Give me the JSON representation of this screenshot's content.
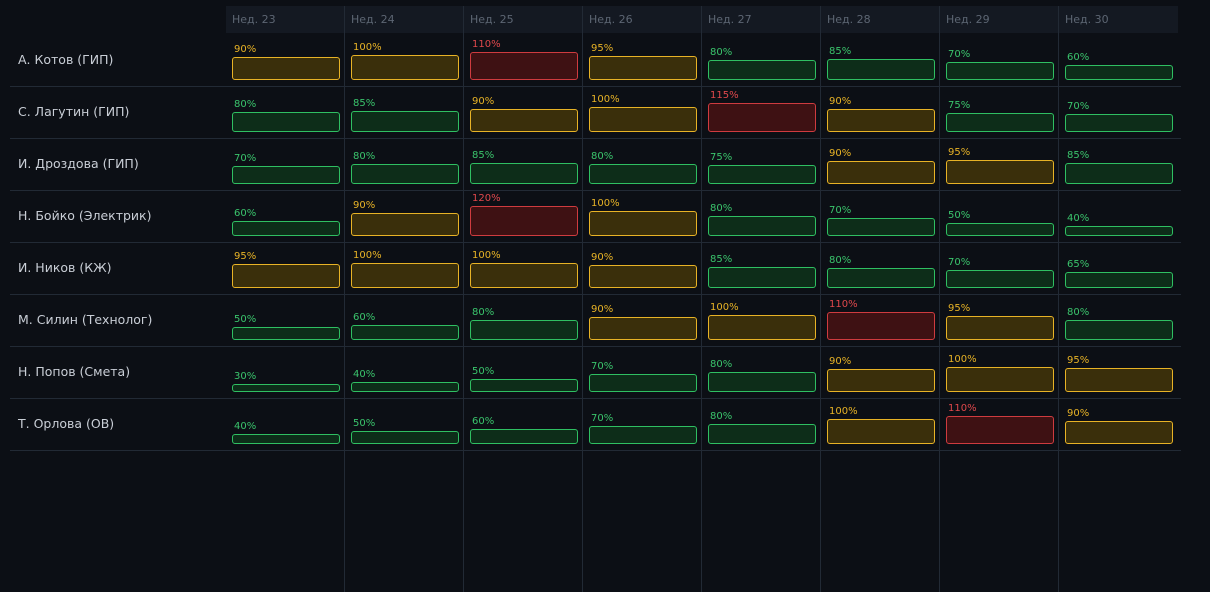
{
  "weeks": [
    "Нед. 23",
    "Нед. 24",
    "Нед. 25",
    "Нед. 26",
    "Нед. 27",
    "Нед. 28",
    "Нед. 29",
    "Нед. 30"
  ],
  "people": [
    {
      "name": "А. Котов (ГИП)",
      "load": [
        90,
        100,
        110,
        95,
        80,
        85,
        70,
        60
      ]
    },
    {
      "name": "С. Лагутин (ГИП)",
      "load": [
        80,
        85,
        90,
        100,
        115,
        90,
        75,
        70
      ]
    },
    {
      "name": "И. Дроздова (ГИП)",
      "load": [
        70,
        80,
        85,
        80,
        75,
        90,
        95,
        85
      ]
    },
    {
      "name": "Н. Бойко (Электрик)",
      "load": [
        60,
        90,
        120,
        100,
        80,
        70,
        50,
        40
      ]
    },
    {
      "name": "И. Ников (КЖ)",
      "load": [
        95,
        100,
        100,
        90,
        85,
        80,
        70,
        65
      ]
    },
    {
      "name": "М. Силин (Технолог)",
      "load": [
        50,
        60,
        80,
        90,
        100,
        110,
        95,
        80
      ]
    },
    {
      "name": "Н. Попов (Смета)",
      "load": [
        30,
        40,
        50,
        70,
        80,
        90,
        100,
        95
      ]
    },
    {
      "name": "Т. Орлова (ОВ)",
      "load": [
        40,
        50,
        60,
        70,
        80,
        100,
        110,
        90
      ]
    }
  ],
  "status_colors": {
    "normal": "#2fbf62",
    "high": "#e8b326",
    "over": "#cf3b3f"
  }
}
